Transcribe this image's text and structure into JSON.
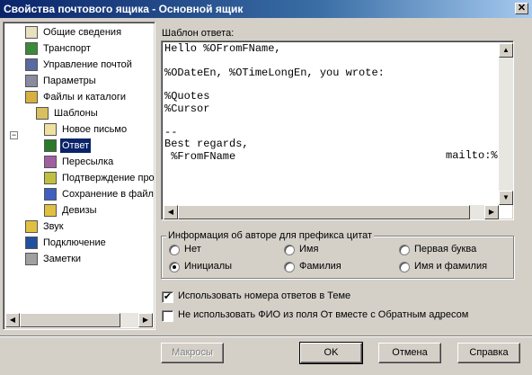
{
  "window": {
    "title": "Свойства почтового ящика - Основной ящик",
    "close_glyph": "✕"
  },
  "tree": {
    "items": [
      {
        "label": "Общие сведения",
        "icon": "info-card-icon"
      },
      {
        "label": "Транспорт",
        "icon": "transport-icon"
      },
      {
        "label": "Управление почтой",
        "icon": "mail-manage-icon"
      },
      {
        "label": "Параметры",
        "icon": "parameters-icon"
      },
      {
        "label": "Файлы и каталоги",
        "icon": "folders-icon"
      },
      {
        "label": "Шаблоны",
        "icon": "templates-icon"
      },
      {
        "label": "Новое письмо",
        "icon": "new-letter-icon"
      },
      {
        "label": "Ответ",
        "icon": "reply-icon"
      },
      {
        "label": "Пересылка",
        "icon": "forward-icon"
      },
      {
        "label": "Подтверждение про",
        "icon": "confirm-icon"
      },
      {
        "label": "Сохранение в файл",
        "icon": "save-file-icon"
      },
      {
        "label": "Девизы",
        "icon": "mottos-icon"
      },
      {
        "label": "Звук",
        "icon": "sound-icon"
      },
      {
        "label": "Подключение",
        "icon": "connection-icon"
      },
      {
        "label": "Заметки",
        "icon": "notes-icon"
      }
    ],
    "selected_index": 7,
    "expander_glyph": "−"
  },
  "editor": {
    "label": "Шаблон ответа:",
    "lines": [
      "Hello %OFromFName,",
      "",
      "%ODateEn, %OTimeLongEn, you wrote:",
      "",
      "%Quotes",
      "%Cursor",
      "",
      "--",
      "Best regards,",
      " %FromFName"
    ],
    "right_fragment": "mailto:%"
  },
  "quote_group": {
    "title": "Информация об авторе для префикса цитат",
    "options": [
      {
        "label": "Нет",
        "checked": false
      },
      {
        "label": "Имя",
        "checked": false
      },
      {
        "label": "Первая буква",
        "checked": false
      },
      {
        "label": "Инициалы",
        "checked": true
      },
      {
        "label": "Фамилия",
        "checked": false
      },
      {
        "label": "Имя и фамилия",
        "checked": false
      }
    ]
  },
  "checkboxes": [
    {
      "label": "Использовать номера ответов в Теме",
      "checked": true
    },
    {
      "label": "Не использовать ФИО из поля От вместе с Обратным адресом",
      "checked": false
    }
  ],
  "check_glyph": "✔",
  "buttons": {
    "macros": "Макросы",
    "ok": "OK",
    "cancel": "Отмена",
    "help": "Справка"
  },
  "scroll_glyphs": {
    "left": "◀",
    "right": "▶",
    "up": "▲",
    "down": "▼"
  }
}
